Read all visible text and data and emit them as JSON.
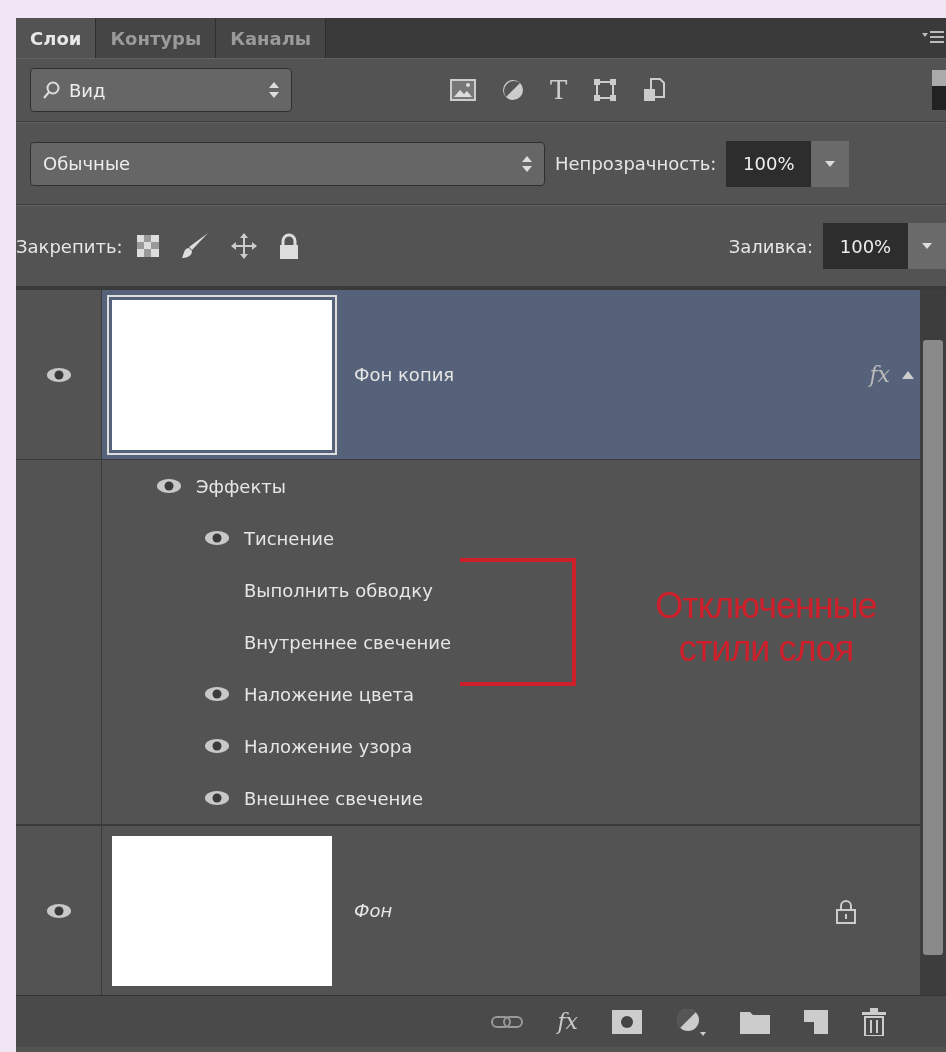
{
  "tabs": [
    {
      "label": "Слои",
      "selected": true
    },
    {
      "label": "Контуры",
      "selected": false
    },
    {
      "label": "Каналы",
      "selected": false
    }
  ],
  "filter": {
    "value": "Вид",
    "type_filter_label": "T"
  },
  "blend_mode": {
    "value": "Обычные"
  },
  "opacity": {
    "label": "Непрозрачность:",
    "value": "100%"
  },
  "lock": {
    "label": "Закрепить:"
  },
  "fill": {
    "label": "Заливка:",
    "value": "100%"
  },
  "layers": [
    {
      "name": "Фон копия",
      "selected": true,
      "visible": true,
      "italic": false,
      "locked": false,
      "fx_label": "fx",
      "effects": [
        {
          "label": "Эффекты",
          "visible": true,
          "children": [
            {
              "label": "Тиснение",
              "visible": true
            },
            {
              "label": "Выполнить обводку",
              "visible": false
            },
            {
              "label": "Внутреннее свечение",
              "visible": false
            },
            {
              "label": "Наложение цвета",
              "visible": true
            },
            {
              "label": "Наложение узора",
              "visible": true
            },
            {
              "label": "Внешнее свечение",
              "visible": true
            }
          ]
        }
      ]
    },
    {
      "name": "Фон",
      "selected": false,
      "visible": true,
      "italic": true,
      "locked": true
    }
  ],
  "annotation": {
    "lines": [
      "Отключенные",
      "стили слоя"
    ]
  },
  "footer": {
    "fx_label": "fx"
  }
}
